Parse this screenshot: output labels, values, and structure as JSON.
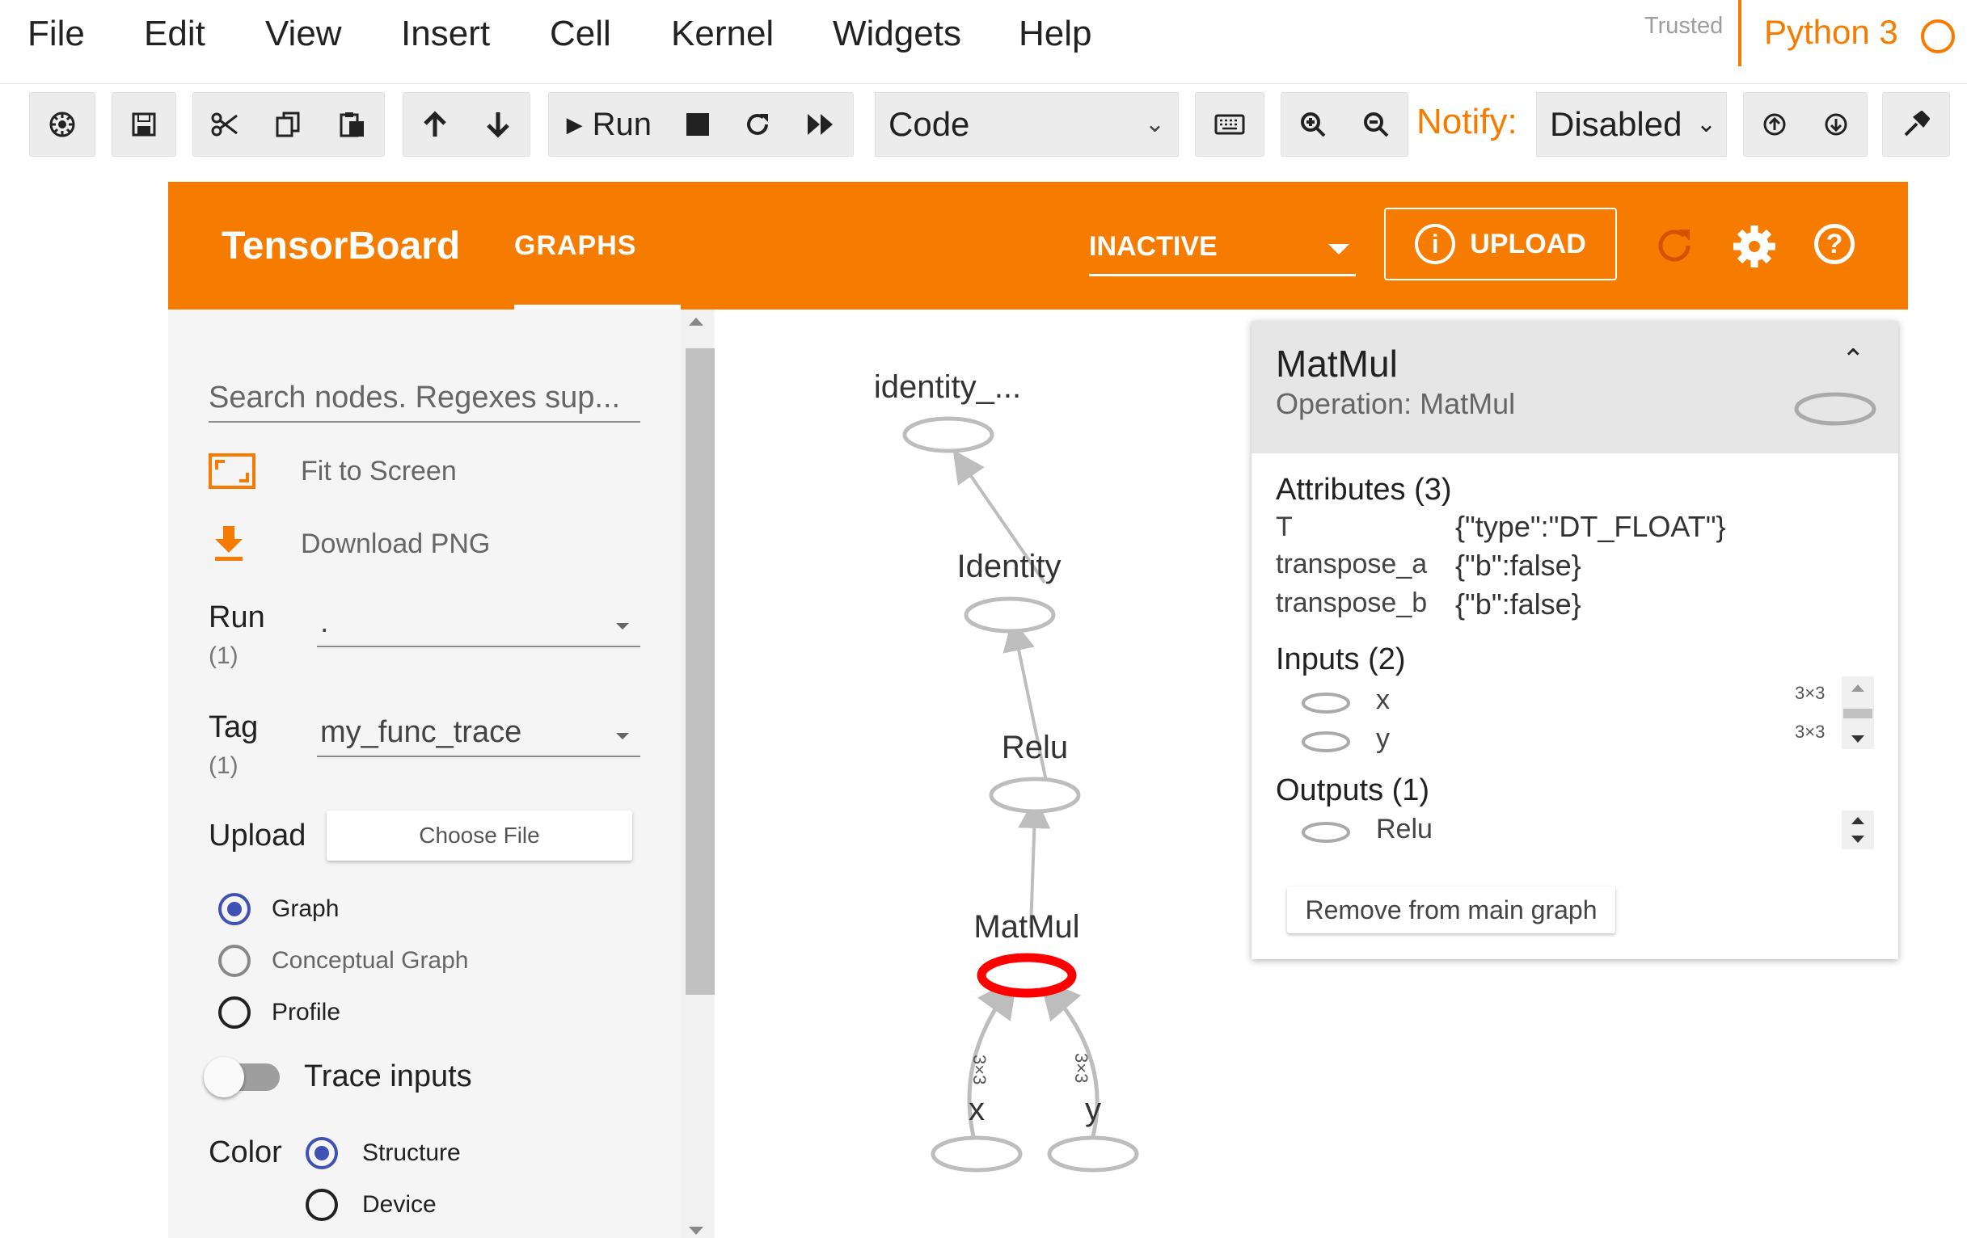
{
  "menubar": {
    "items": [
      "File",
      "Edit",
      "View",
      "Insert",
      "Cell",
      "Kernel",
      "Widgets",
      "Help"
    ],
    "trusted": "Trusted",
    "kernel_name": "Python 3"
  },
  "toolbar": {
    "run_label": "Run",
    "cell_type": "Code",
    "notify_label": "Notify:",
    "notify_value": "Disabled",
    "icons": [
      "gear-icon",
      "save-icon",
      "cut-icon",
      "copy-icon",
      "paste-icon",
      "arrow-up-icon",
      "arrow-down-icon",
      "run-icon",
      "stop-icon",
      "restart-icon",
      "fast-forward-icon",
      "keyboard-icon",
      "zoom-in-icon",
      "zoom-out-icon",
      "upload-icon",
      "download-icon",
      "wrench-icon"
    ]
  },
  "tensorboard": {
    "title": "TensorBoard",
    "tab": "GRAPHS",
    "run_selector": "INACTIVE",
    "upload_label": "UPLOAD",
    "accent": "#f57c00"
  },
  "sidebar": {
    "search_placeholder": "Search nodes. Regexes sup...",
    "fit_label": "Fit to Screen",
    "download_label": "Download PNG",
    "run_label": "Run",
    "run_count": "(1)",
    "run_value": ".",
    "tag_label": "Tag",
    "tag_count": "(1)",
    "tag_value": "my_func_trace",
    "upload_label": "Upload",
    "choose_file": "Choose File",
    "graph_types": [
      {
        "label": "Graph",
        "selected": true
      },
      {
        "label": "Conceptual Graph",
        "selected": false
      },
      {
        "label": "Profile",
        "selected": false
      }
    ],
    "trace_inputs": "Trace inputs",
    "color_label": "Color",
    "color_options": [
      {
        "label": "Structure",
        "selected": true
      },
      {
        "label": "Device",
        "selected": false
      }
    ]
  },
  "graph": {
    "nodes": [
      "identity_...",
      "Identity",
      "Relu",
      "MatMul",
      "x",
      "y"
    ],
    "edge_labels": [
      "3×3",
      "3×3"
    ],
    "selected_color": "#ff0000"
  },
  "info_card": {
    "title": "MatMul",
    "operation": "Operation: MatMul",
    "attributes_header": "Attributes (3)",
    "attributes": [
      {
        "key": "T",
        "value": "{\"type\":\"DT_FLOAT\"}"
      },
      {
        "key": "transpose_a",
        "value": "{\"b\":false}"
      },
      {
        "key": "transpose_b",
        "value": "{\"b\":false}"
      }
    ],
    "inputs_header": "Inputs (2)",
    "inputs": [
      {
        "name": "x",
        "shape": "3×3"
      },
      {
        "name": "y",
        "shape": "3×3"
      }
    ],
    "outputs_header": "Outputs (1)",
    "outputs": [
      {
        "name": "Relu"
      }
    ],
    "remove_label": "Remove from main graph"
  }
}
